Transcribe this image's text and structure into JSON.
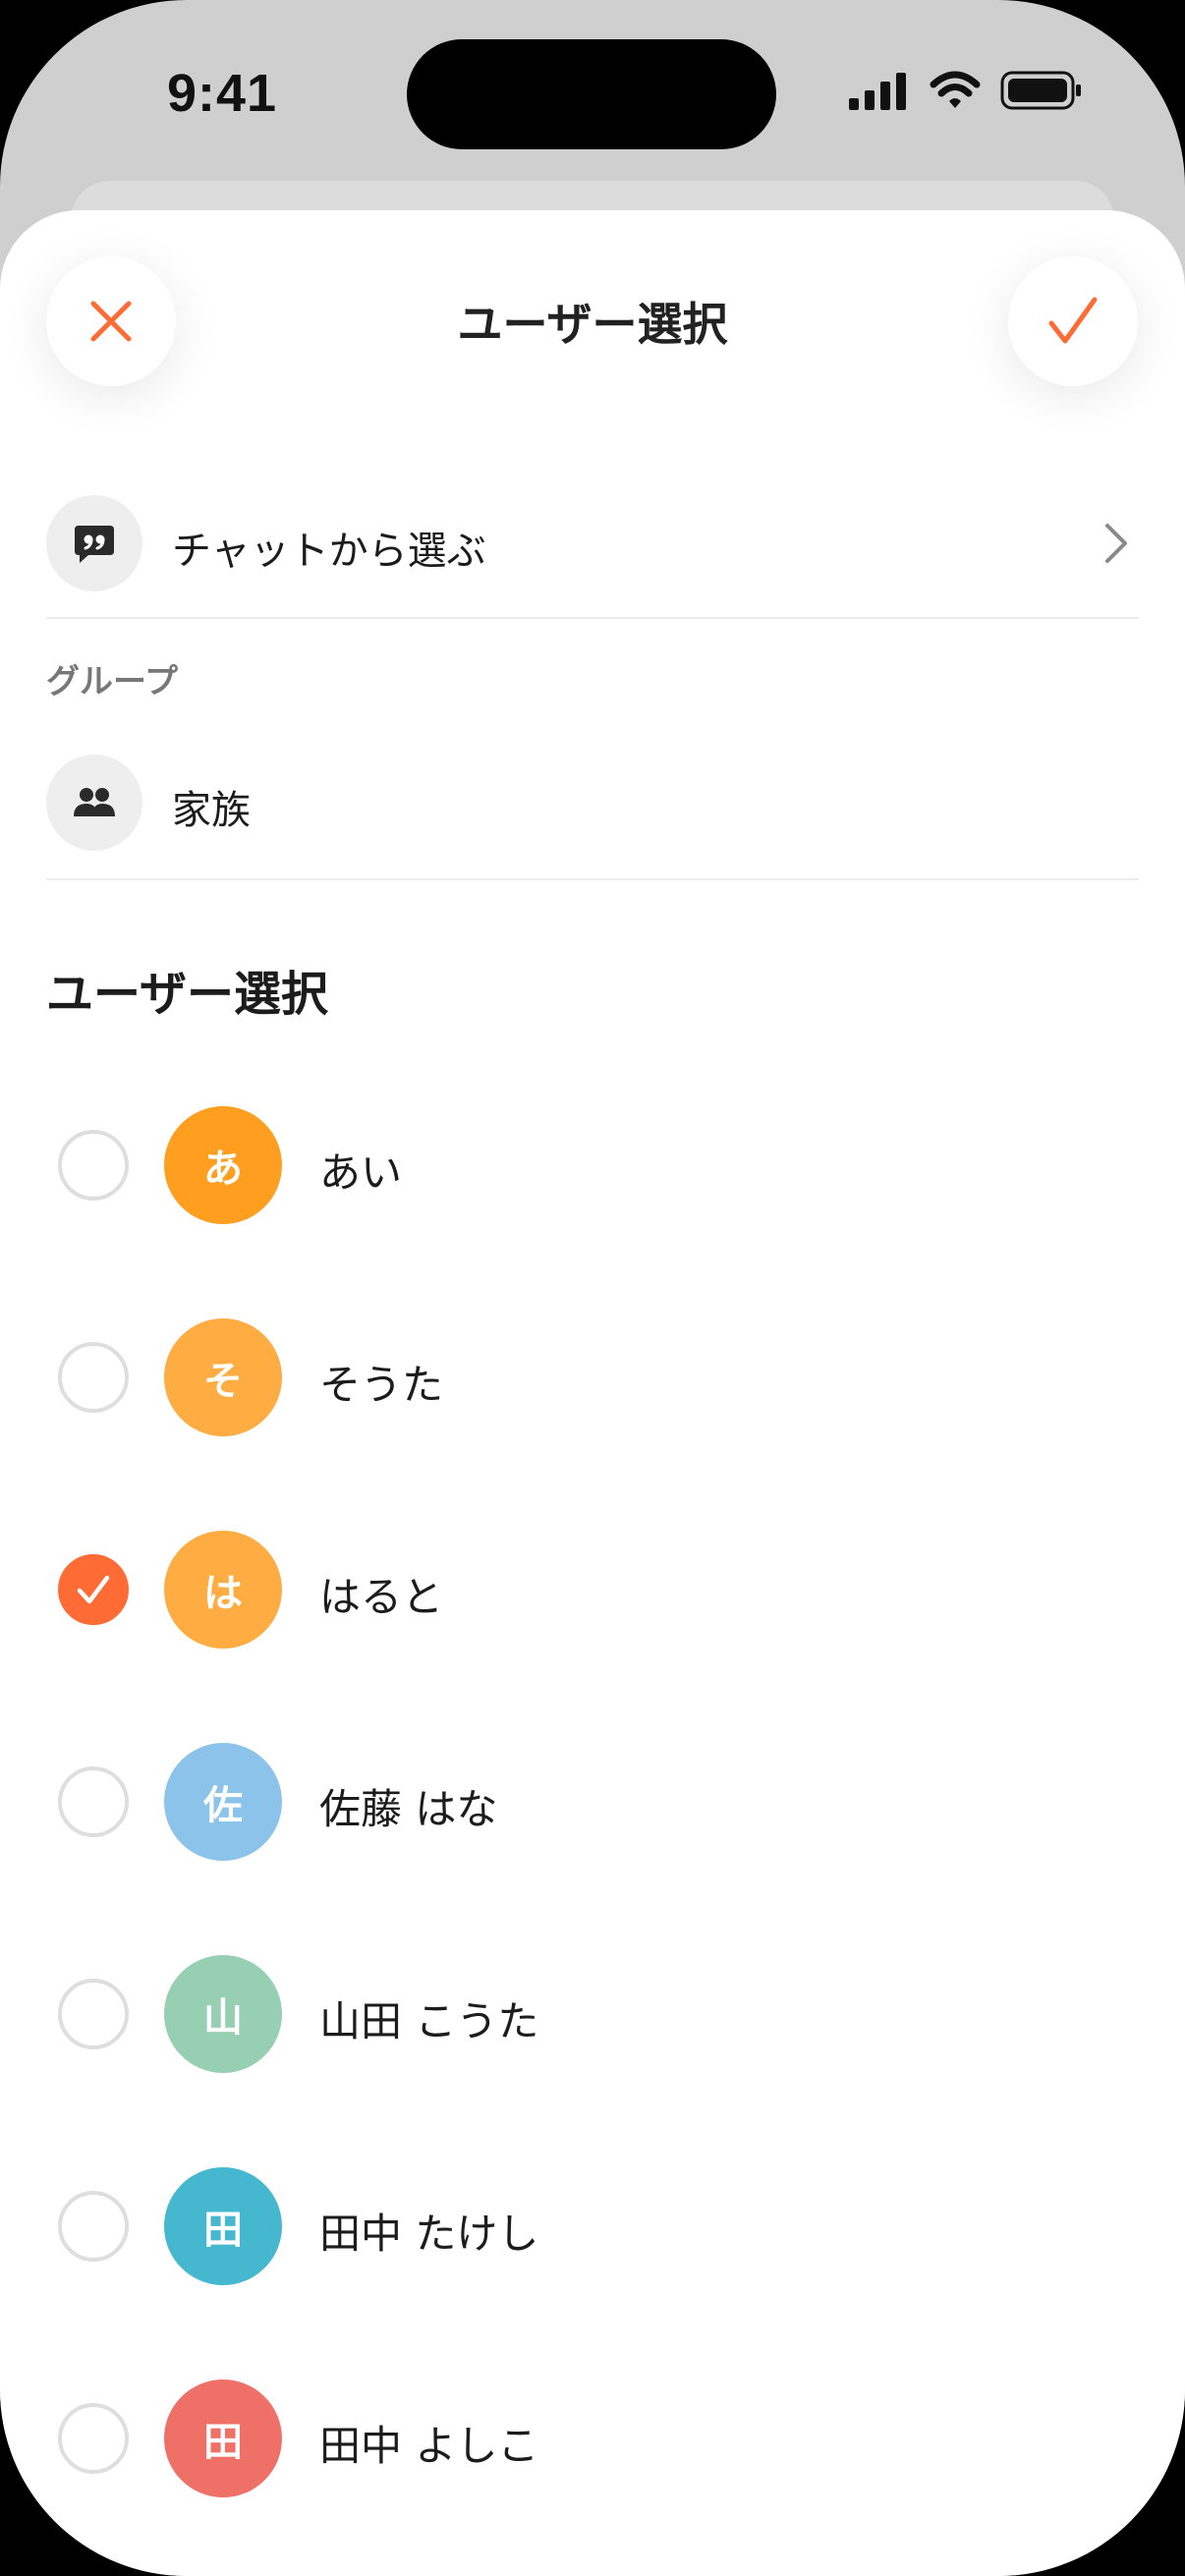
{
  "status_bar": {
    "time": "9:41"
  },
  "header": {
    "title": "ユーザー選択"
  },
  "chat_row": {
    "label": "チャットから選ぶ",
    "icon": "chat-quote-icon"
  },
  "groups": {
    "header": "グループ",
    "items": [
      {
        "label": "家族",
        "icon": "people-icon"
      }
    ]
  },
  "users_section": {
    "title": "ユーザー選択",
    "users": [
      {
        "initial": "あ",
        "name": "あい",
        "color": "#ff9e1f",
        "selected": false
      },
      {
        "initial": "そ",
        "name": "そうた",
        "color": "#ffac42",
        "selected": false
      },
      {
        "initial": "は",
        "name": "はると",
        "color": "#ffac42",
        "selected": true
      },
      {
        "initial": "佐",
        "name": "佐藤 はな",
        "color": "#8cc3ea",
        "selected": false
      },
      {
        "initial": "山",
        "name": "山田 こうた",
        "color": "#96cfb2",
        "selected": false
      },
      {
        "initial": "田",
        "name": "田中 たけし",
        "color": "#45b8d0",
        "selected": false
      },
      {
        "initial": "田",
        "name": "田中 よしこ",
        "color": "#ef7066",
        "selected": false
      }
    ]
  },
  "colors": {
    "accent": "#ff6b35",
    "divider": "#ececec",
    "icon_bg": "#eeeeef"
  }
}
